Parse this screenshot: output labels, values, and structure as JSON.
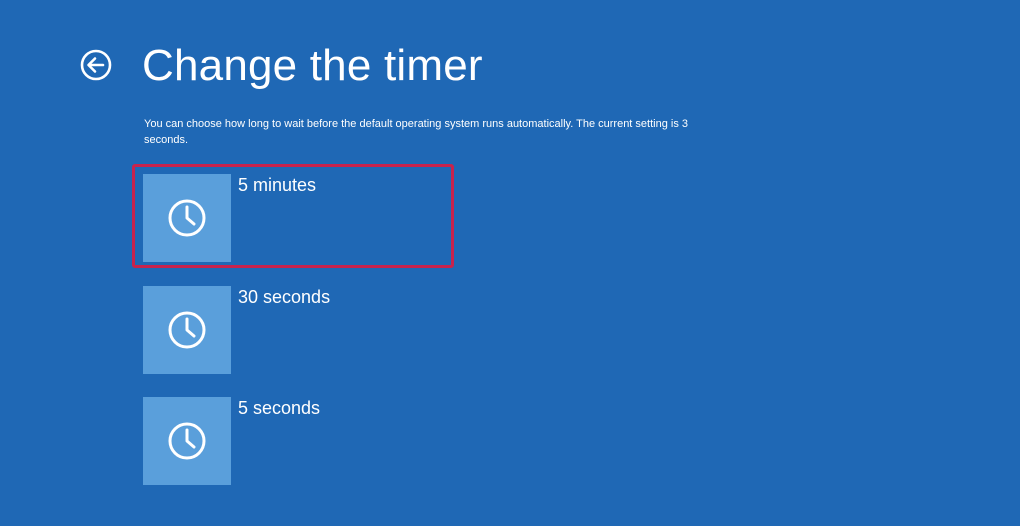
{
  "header": {
    "back_icon": "back-arrow-circle-icon",
    "title": "Change the timer"
  },
  "description": "You can choose how long to wait before the default operating system runs automatically. The current setting is 3 seconds.",
  "options": [
    {
      "label": "5 minutes",
      "icon": "clock-icon",
      "highlighted": true
    },
    {
      "label": "30 seconds",
      "icon": "clock-icon",
      "highlighted": false
    },
    {
      "label": "5 seconds",
      "icon": "clock-icon",
      "highlighted": false
    }
  ],
  "colors": {
    "background": "#1f68b5",
    "tile": "#5a9fdb",
    "highlight": "#c8234d",
    "text": "#ffffff"
  }
}
